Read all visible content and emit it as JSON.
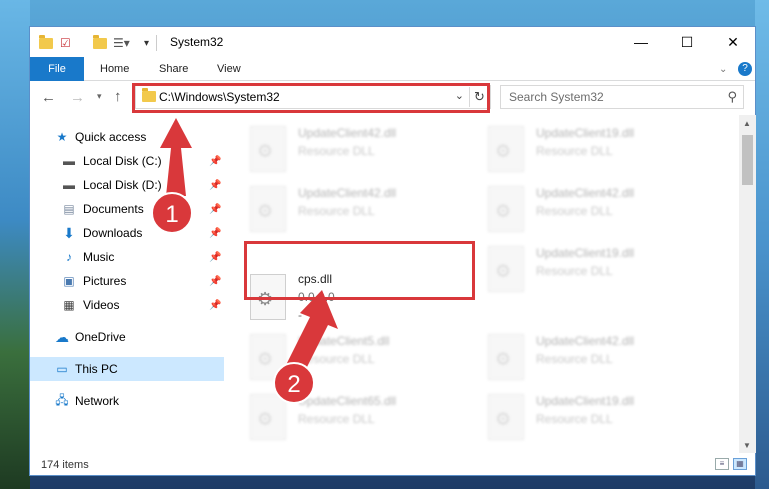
{
  "window": {
    "title": "System32",
    "controls": {
      "minimize": "—",
      "maximize": "☐",
      "close": "✕"
    }
  },
  "ribbon": {
    "file": "File",
    "tabs": [
      "Home",
      "Share",
      "View"
    ]
  },
  "address": {
    "path": "C:\\Windows\\System32"
  },
  "search": {
    "placeholder": "Search System32"
  },
  "sidebar": {
    "items": [
      {
        "label": "Quick access"
      },
      {
        "label": "Local Disk (C:)"
      },
      {
        "label": "Local Disk (D:)"
      },
      {
        "label": "Documents"
      },
      {
        "label": "Downloads"
      },
      {
        "label": "Music"
      },
      {
        "label": "Pictures"
      },
      {
        "label": "Videos"
      },
      {
        "label": "OneDrive"
      },
      {
        "label": "This PC"
      },
      {
        "label": "Network"
      }
    ]
  },
  "files": [
    {
      "name": "UpdateClient42.dll",
      "desc": "Resource DLL"
    },
    {
      "name": "UpdateClient19.dll",
      "desc": "Resource DLL"
    },
    {
      "name": "UpdateClient42.dll",
      "desc": "Resource DLL"
    },
    {
      "name": "UpdateClient42.dll",
      "desc": "Resource DLL"
    },
    {
      "name": "cps.dll",
      "desc": "0.0.0.0",
      "extra": "-"
    },
    {
      "name": "UpdateClient19.dll",
      "desc": "Resource DLL"
    },
    {
      "name": "UpdateClient5.dll",
      "desc": "Resource DLL"
    },
    {
      "name": "UpdateClient42.dll",
      "desc": "Resource DLL"
    },
    {
      "name": "UpdateClient65.dll",
      "desc": "Resource DLL"
    },
    {
      "name": "UpdateClient19.dll",
      "desc": "Resource DLL"
    }
  ],
  "status": {
    "count": "174 items"
  },
  "annotations": {
    "step1": "1",
    "step2": "2"
  },
  "colors": {
    "accent": "#1979ca",
    "annotation": "#d9383b",
    "selection": "#cce8ff"
  }
}
